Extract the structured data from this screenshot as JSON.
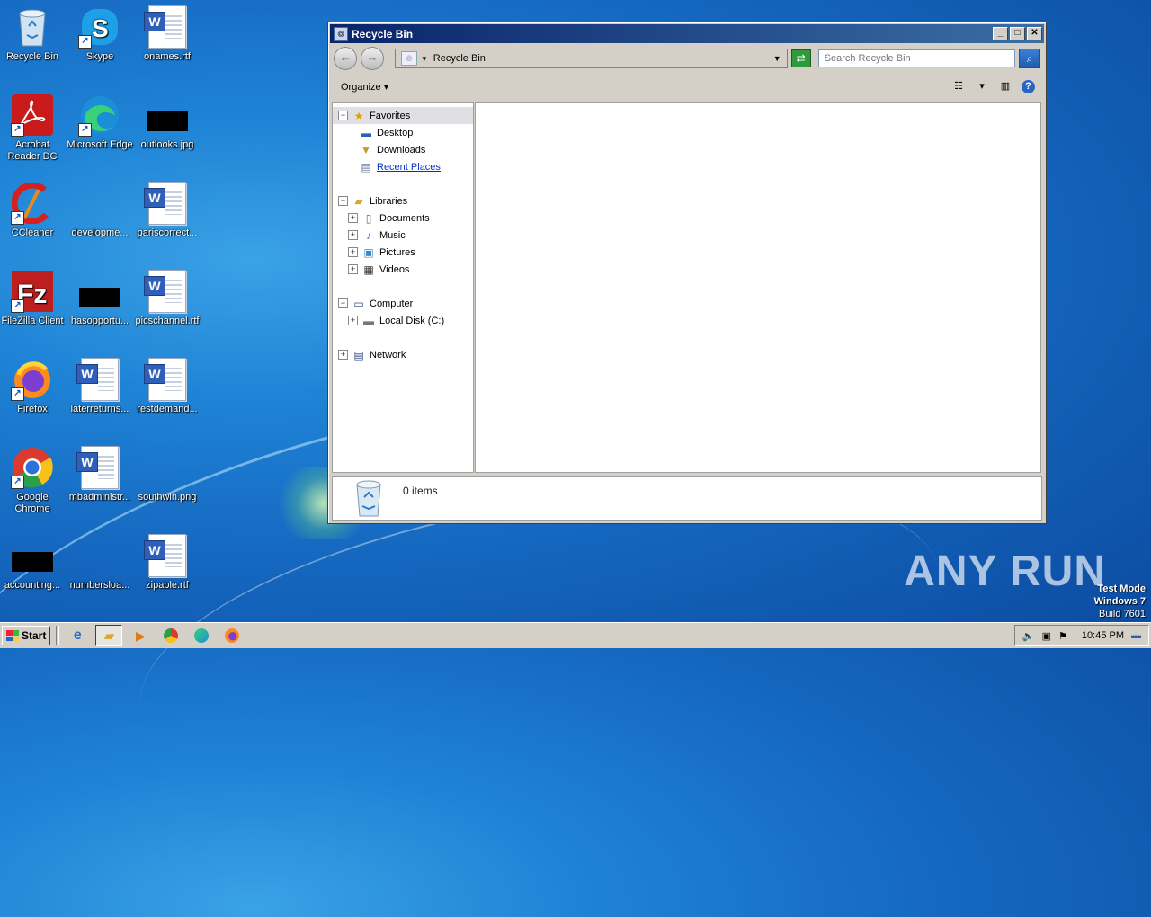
{
  "desktop": {
    "icons": [
      {
        "label": "Recycle Bin"
      },
      {
        "label": "Skype"
      },
      {
        "label": "onames.rtf"
      },
      {
        "label": "Acrobat Reader DC"
      },
      {
        "label": "Microsoft Edge"
      },
      {
        "label": "outlooks.jpg"
      },
      {
        "label": "CCleaner"
      },
      {
        "label": "developme..."
      },
      {
        "label": "pariscorrect..."
      },
      {
        "label": "FileZilla Client"
      },
      {
        "label": "hasopportu..."
      },
      {
        "label": "picschannel.rtf"
      },
      {
        "label": "Firefox"
      },
      {
        "label": "laterreturns..."
      },
      {
        "label": "restdemand..."
      },
      {
        "label": "Google Chrome"
      },
      {
        "label": "mbadministr..."
      },
      {
        "label": "southwin.png"
      },
      {
        "label": "accounting..."
      },
      {
        "label": "numbersloa..."
      },
      {
        "label": "zipable.rtf"
      }
    ]
  },
  "window": {
    "title": "Recycle Bin",
    "address": "Recycle Bin",
    "search_placeholder": "Search Recycle Bin",
    "organize_label": "Organize",
    "nav": {
      "favorites": "Favorites",
      "desktop": "Desktop",
      "downloads": "Downloads",
      "recent_places": "Recent Places",
      "libraries": "Libraries",
      "documents": "Documents",
      "music": "Music",
      "pictures": "Pictures",
      "videos": "Videos",
      "computer": "Computer",
      "local_disk": "Local Disk (C:)",
      "network": "Network"
    },
    "status_text": "0 items"
  },
  "taskbar": {
    "start_label": "Start",
    "clock": "10:45 PM"
  },
  "overlay": {
    "watermark": "ANY RUN",
    "testmode_line1": "Test Mode",
    "testmode_line2": "Windows 7",
    "testmode_line3": "Build 7601"
  }
}
